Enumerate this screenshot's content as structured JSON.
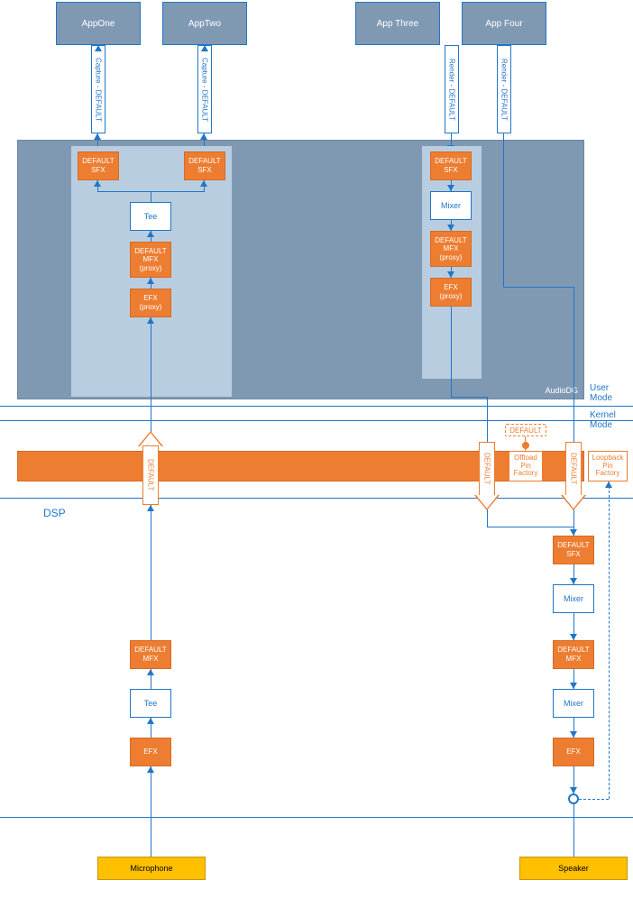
{
  "apps": [
    {
      "label": "AppOne",
      "connector": "Capture - DEFAULT"
    },
    {
      "label": "AppTwo",
      "connector": "Capture - DEFAULT"
    },
    {
      "label": "App Three",
      "connector": "Render - DEFAULT"
    },
    {
      "label": "App Four",
      "connector": "Render - DEFAULT"
    }
  ],
  "audiodg_label": "AudioDG",
  "capture_chain": {
    "sfx1": "DEFAULT\nSFX",
    "sfx2": "DEFAULT\nSFX",
    "tee": "Tee",
    "mfx": "DEFAULT\nMFX\n(proxy)",
    "efx": "EFX\n(proxy)"
  },
  "render_chain": {
    "sfx": "DEFAULT\nSFX",
    "mixer": "Mixer",
    "mfx": "DEFAULT\nMFX\n(proxy)",
    "efx": "EFX\n(proxy)"
  },
  "mode_labels": {
    "user": "User\nMode",
    "kernel": "Kernel\nMode"
  },
  "dsp_label": "DSP",
  "default_badge": "DEFAULT",
  "offload_pin": "Offload\nPin\nFactory",
  "loopback_pin": "Loopback\nPin\nFactory",
  "hollow_arrow_label": "DEFAULT",
  "dsp_capture": {
    "mfx": "DEFAULT\nMFX",
    "tee": "Tee",
    "efx": "EFX"
  },
  "dsp_render": {
    "sfx": "DEFAULT\nSFX",
    "mixer1": "Mixer",
    "mfx": "DEFAULT\nMFX",
    "mixer2": "Mixer",
    "efx": "EFX"
  },
  "devices": {
    "mic": "Microphone",
    "speaker": "Speaker"
  }
}
